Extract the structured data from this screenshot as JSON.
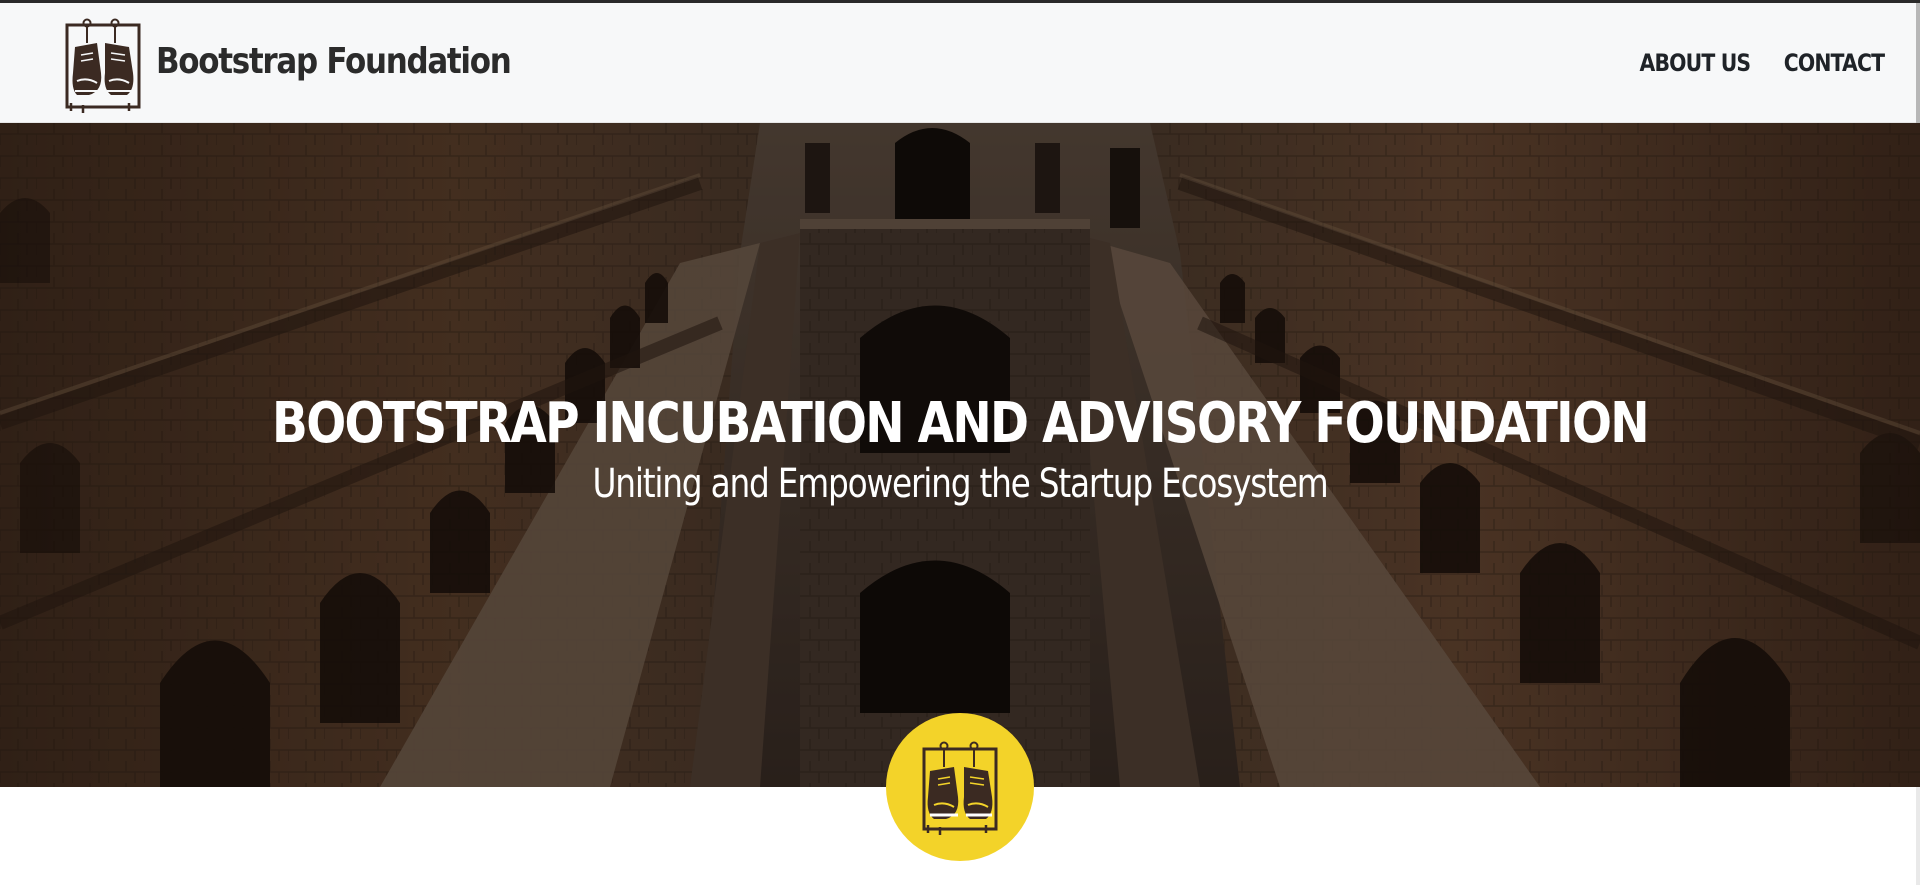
{
  "header": {
    "brand_name": "Bootstrap Foundation",
    "logo_icon": "hanging-sneakers-icon",
    "nav": [
      {
        "label": "ABOUT US"
      },
      {
        "label": "CONTACT"
      }
    ]
  },
  "hero": {
    "title": "BOOTSTRAP INCUBATION AND ADVISORY FOUNDATION",
    "subtitle": "Uniting and Empowering the Startup Ecosystem",
    "background": "stepwell-arches-photo"
  },
  "badge": {
    "icon": "hanging-sneakers-icon",
    "color": "#f3d329"
  },
  "colors": {
    "nav_background": "#f7f8f9",
    "text_dark": "#2b2b2b",
    "hero_text": "#ffffff",
    "badge_yellow": "#f3d329"
  }
}
